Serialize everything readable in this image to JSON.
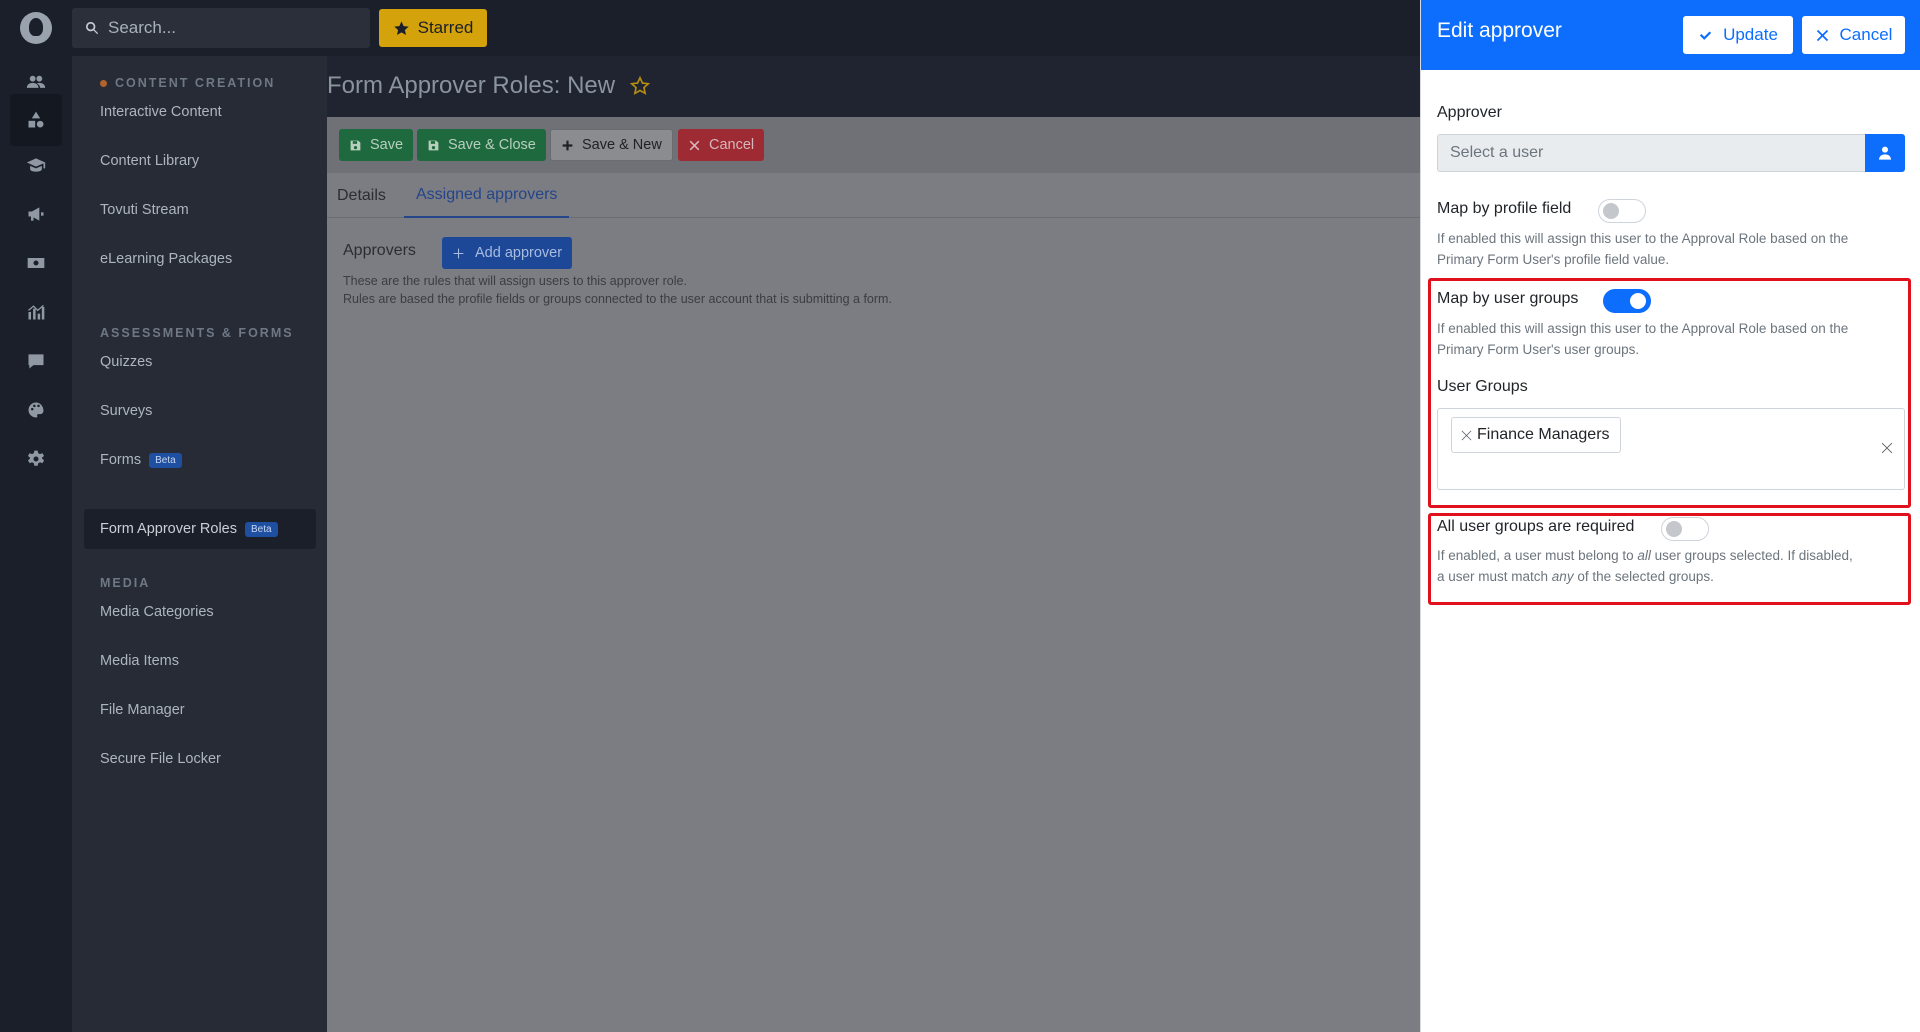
{
  "rail": {
    "items": [
      {
        "icon": "users-icon"
      },
      {
        "icon": "shapes-icon"
      },
      {
        "icon": "graduation-cap-icon"
      },
      {
        "icon": "megaphone-icon"
      },
      {
        "icon": "money-icon"
      },
      {
        "icon": "chart-icon"
      },
      {
        "icon": "comment-icon"
      },
      {
        "icon": "palette-icon"
      },
      {
        "icon": "gear-icon"
      }
    ]
  },
  "topbar": {
    "search_placeholder": "Search...",
    "starred_label": "Starred"
  },
  "sidebar": {
    "sections": [
      {
        "title": "CONTENT CREATION",
        "items": [
          "Interactive Content",
          "Content Library",
          "Tovuti Stream",
          "eLearning Packages"
        ]
      },
      {
        "title": "ASSESSMENTS & FORMS",
        "items": [
          "Quizzes",
          "Surveys",
          "Forms",
          "Form Approver Roles"
        ]
      },
      {
        "title": "MEDIA",
        "items": [
          "Media Categories",
          "Media Items",
          "File Manager",
          "Secure File Locker"
        ]
      }
    ],
    "badge_label": "Beta",
    "active_item": "Form Approver Roles"
  },
  "main": {
    "title": "Form Approver Roles: New",
    "toolbar": {
      "save": "Save",
      "save_close": "Save & Close",
      "save_new": "Save & New",
      "cancel": "Cancel"
    },
    "tabs": [
      "Details",
      "Assigned approvers"
    ],
    "active_tab": "Assigned approvers",
    "approvers_label": "Approvers",
    "add_approver": "Add approver",
    "help_line1": "These are the rules that will assign users to this approver role.",
    "help_line2": "Rules are based the profile fields or groups connected to the user account that is submitting a form."
  },
  "drawer": {
    "title": "Edit approver",
    "update": "Update",
    "cancel": "Cancel",
    "approver_label": "Approver",
    "approver_placeholder": "Select a user",
    "map_profile_label": "Map by profile field",
    "map_profile_on": false,
    "map_profile_desc1": "If enabled this will assign this user to the Approval Role based on the",
    "map_profile_desc2": "Primary Form User's profile field value.",
    "map_groups_label": "Map by user groups",
    "map_groups_on": true,
    "map_groups_desc1": "If enabled this will assign this user to the Approval Role based on the",
    "map_groups_desc2": "Primary Form User's user groups.",
    "user_groups_label": "User Groups",
    "selected_group": "Finance Managers",
    "all_required_label": "All user groups are required",
    "all_required_on": false,
    "all_required_desc_a": "If enabled, a user must belong to ",
    "all_required_desc_all": "all",
    "all_required_desc_b": " user groups selected. If disabled,",
    "all_required_desc_c": "a user must match ",
    "all_required_desc_any": "any",
    "all_required_desc_d": " of the selected groups."
  },
  "colors": {
    "primary": "#0d6efd",
    "highlight": "#e0101c",
    "starred": "#d4a30b"
  }
}
